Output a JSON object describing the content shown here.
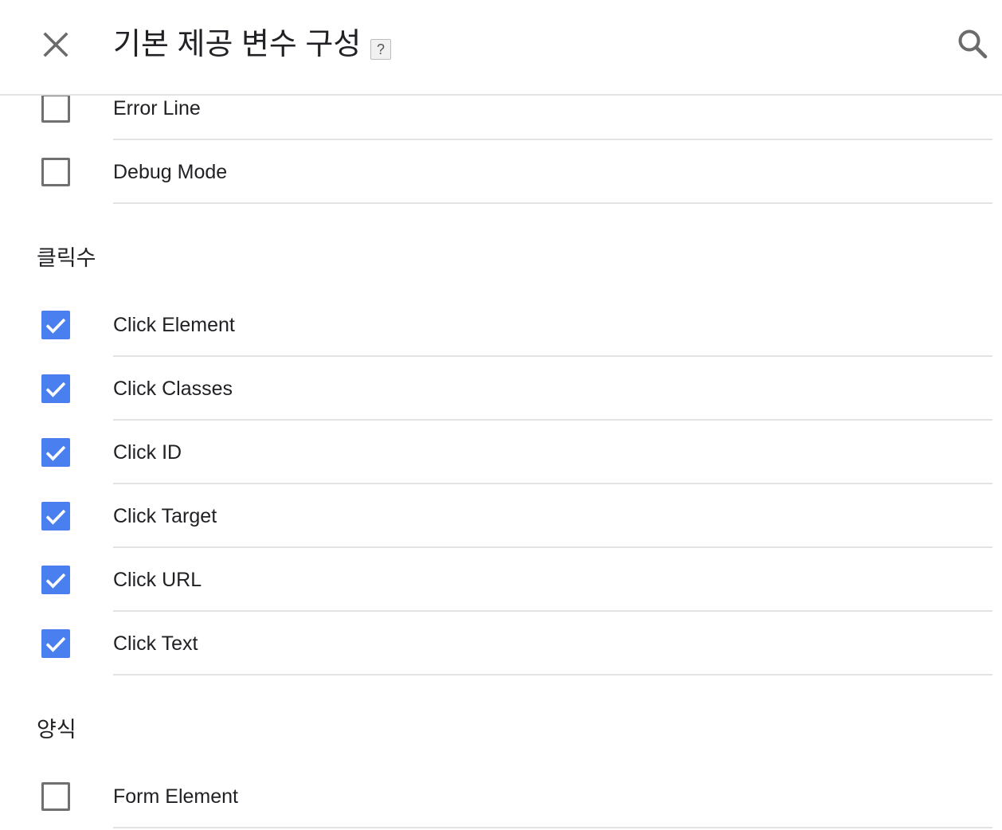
{
  "header": {
    "title": "기본 제공 변수 구성",
    "help": "?",
    "close_icon": "close-icon",
    "search_icon": "search-icon"
  },
  "colors": {
    "checkbox_checked": "#4a7ff0",
    "checkbox_unchecked_border": "#707070",
    "divider": "#e3e3e3"
  },
  "groups": {
    "top": {
      "items": [
        {
          "label": "Error Line",
          "checked": false
        },
        {
          "label": "Debug Mode",
          "checked": false
        }
      ]
    },
    "clicks": {
      "heading": "클릭수",
      "items": [
        {
          "label": "Click Element",
          "checked": true
        },
        {
          "label": "Click Classes",
          "checked": true
        },
        {
          "label": "Click ID",
          "checked": true
        },
        {
          "label": "Click Target",
          "checked": true
        },
        {
          "label": "Click URL",
          "checked": true
        },
        {
          "label": "Click Text",
          "checked": true
        }
      ]
    },
    "forms": {
      "heading": "양식",
      "items": [
        {
          "label": "Form Element",
          "checked": false
        }
      ]
    }
  }
}
